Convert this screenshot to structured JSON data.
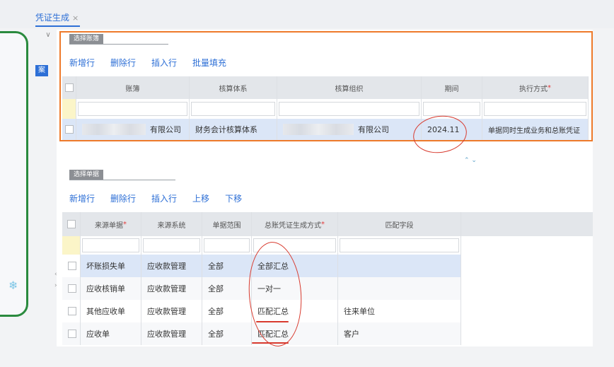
{
  "tab": {
    "title": "凭证生成",
    "close": "×"
  },
  "side": {
    "tag": "案",
    "collapse": "∨",
    "snow": "❄",
    "arrow_left": "‹",
    "arrow_right": "›"
  },
  "section1": {
    "title": "选择账簿",
    "toolbar": [
      "新增行",
      "删除行",
      "插入行",
      "批量填充"
    ],
    "headers": [
      "账簿",
      "核算体系",
      "核算组织",
      "期间",
      "执行方式"
    ],
    "required_mark": "*",
    "row": {
      "book": "有限公司",
      "system": "财务会计核算体系",
      "org": "有限公司",
      "period": "2024.11",
      "exec": "单据同时生成业务和总账凭证"
    }
  },
  "section2": {
    "title": "选择单据",
    "toolbar": [
      "新增行",
      "删除行",
      "插入行",
      "上移",
      "下移"
    ],
    "headers": [
      "来源单据",
      "来源系统",
      "单据范围",
      "总账凭证生成方式",
      "匹配字段"
    ],
    "required_mark": "*",
    "rows": [
      {
        "doc": "坏账损失单",
        "sys": "应收款管理",
        "range": "全部",
        "mode": "全部汇总",
        "field": ""
      },
      {
        "doc": "应收核销单",
        "sys": "应收款管理",
        "range": "全部",
        "mode": "一对一",
        "field": ""
      },
      {
        "doc": "其他应收单",
        "sys": "应收款管理",
        "range": "全部",
        "mode": "匹配汇总",
        "field": "往来单位"
      },
      {
        "doc": "应收单",
        "sys": "应收款管理",
        "range": "全部",
        "mode": "匹配汇总",
        "field": "客户"
      }
    ]
  },
  "colors": {
    "accent": "#2d6fd6",
    "orange_box": "#ee7a2a",
    "red_annotation": "#d83a2e",
    "green_frame": "#2a8a3e",
    "selected_row": "#dbe6f7"
  }
}
